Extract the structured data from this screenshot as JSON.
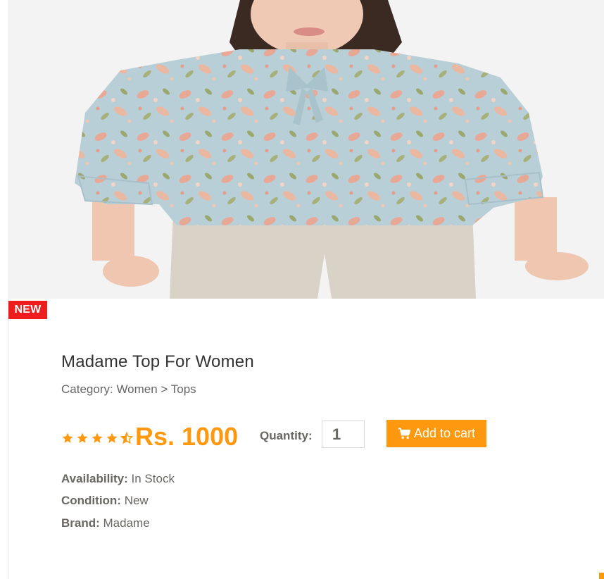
{
  "product": {
    "badge": "NEW",
    "image_alt": "Woman wearing a floral light blue top with bow neck and beige trousers",
    "name": "Madame Top For Women",
    "category": {
      "prefix": "Category:",
      "path": "Women > Tops"
    },
    "rating": 4.5,
    "rating_max": 5,
    "price": "Rs. 1000",
    "quantity_label": "Quantity:",
    "quantity_value": "1",
    "add_to_cart_label": "Add to cart",
    "availability_label": "Availability:",
    "availability_value": "In Stock",
    "condition_label": "Condition:",
    "condition_value": "New",
    "brand_label": "Brand:",
    "brand_value": "Madame"
  },
  "colors": {
    "accent": "#fe980f",
    "badge": "#ee1c1c",
    "text": "#696763"
  },
  "icons": {
    "star": "star-icon",
    "half_star": "star-half-icon",
    "cart": "shopping-cart-icon"
  }
}
